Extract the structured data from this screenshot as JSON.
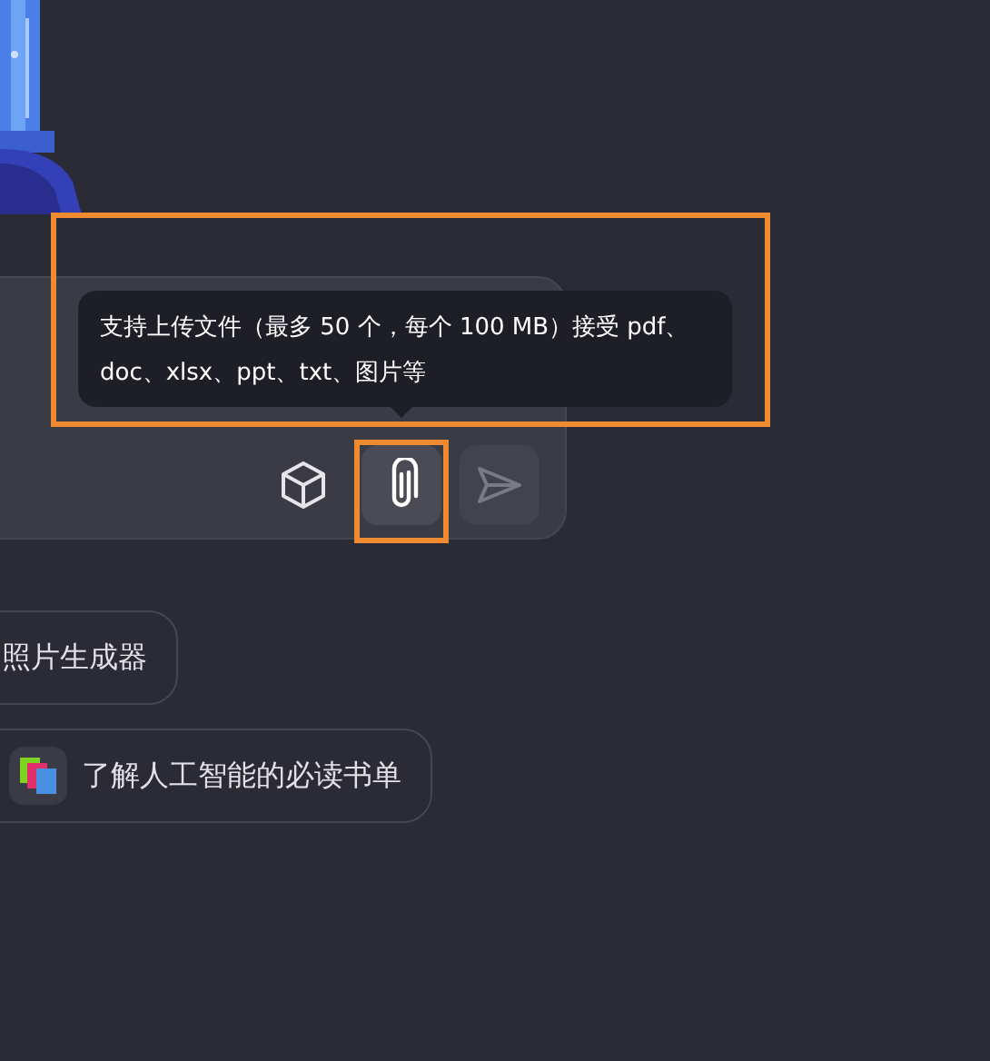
{
  "input_box": {
    "tooltip": {
      "text": "支持上传文件（最多 50 个，每个 100 MB）接受 pdf、doc、xlsx、ppt、txt、图片等",
      "highlighted": true
    },
    "buttons": [
      {
        "kind": "cube",
        "highlighted": false,
        "disabled": false
      },
      {
        "kind": "attach",
        "highlighted": true,
        "disabled": false
      },
      {
        "kind": "send",
        "highlighted": false,
        "disabled": true
      }
    ]
  },
  "suggestions": [
    {
      "label": "照片生成器",
      "icon": false
    },
    {
      "label": "了解人工智能的必读书单",
      "icon": true
    }
  ]
}
